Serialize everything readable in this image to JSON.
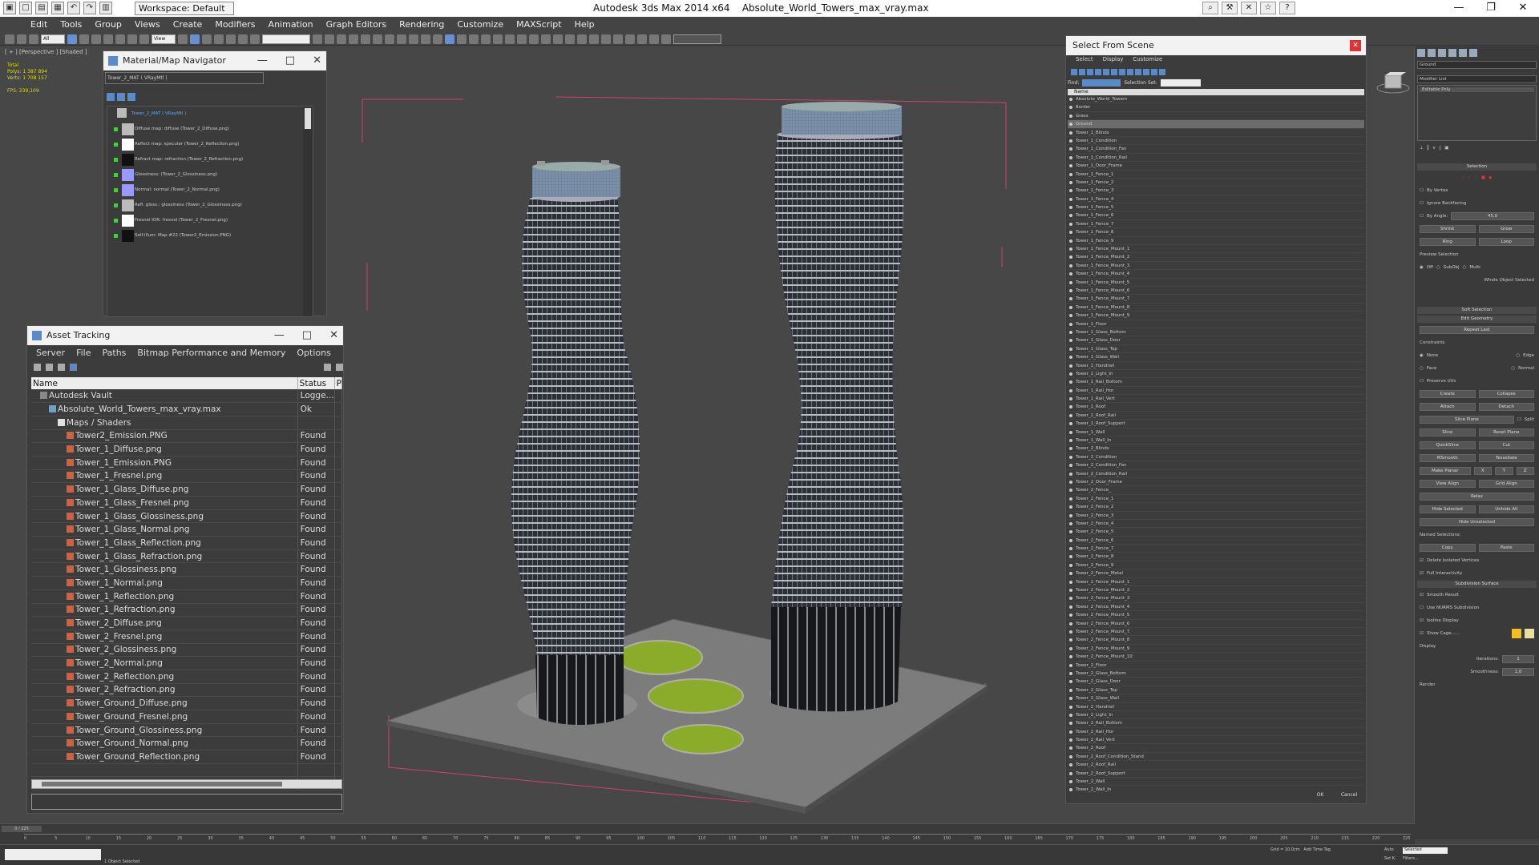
{
  "app": {
    "title": "Autodesk 3ds Max  2014 x64",
    "file": "Absolute_World_Towers_max_vray.max",
    "workspace": "Workspace: Default"
  },
  "menu": [
    "Edit",
    "Tools",
    "Group",
    "Views",
    "Create",
    "Modifiers",
    "Animation",
    "Graph Editors",
    "Rendering",
    "Customize",
    "MAXScript",
    "Help"
  ],
  "toolbar": {
    "selection_filter": "All",
    "view_mode": "View"
  },
  "viewport": {
    "label": "[ + ] [Perspective ] [Shaded ]",
    "stats": {
      "total_label": "Total",
      "polys_label": "Polys:",
      "polys": "1 387 894",
      "verts_label": "Verts:",
      "verts": "1 708 157",
      "fps_label": "FPS:",
      "fps": "239,109"
    }
  },
  "material_navigator": {
    "title": "Material/Map Navigator",
    "path": "Tower_2_MAT  ( VRayMtl )",
    "items": [
      {
        "label": "Tower_2_MAT  ( VRayMtl )",
        "thumb": "top"
      },
      {
        "label": "Diffuse map: diffuse (Tower_2_Diffuse.png)",
        "thumb": "gy"
      },
      {
        "label": "Reflect map: specular (Tower_2_Reflection.png)",
        "thumb": "wh"
      },
      {
        "label": "Refract map: refraction (Tower_2_Refraction.png)",
        "thumb": "dk"
      },
      {
        "label": "Glossiness: (Tower_2_Glossiness.png)",
        "thumb": "pu"
      },
      {
        "label": "Normal: normal (Tower_2_Normal.png)",
        "thumb": "pu"
      },
      {
        "label": "Refl. gloss.: glossiness (Tower_2_Glossiness.png)",
        "thumb": "gy"
      },
      {
        "label": "Fresnel IOR: fresnel (Tower_2_Fresnel.png)",
        "thumb": "wh"
      },
      {
        "label": "Self-illum: Map #22 (Tower2_Emission.PNG)",
        "thumb": "dk"
      }
    ]
  },
  "asset_tracking": {
    "title": "Asset Tracking",
    "menu": [
      "Server",
      "File",
      "Paths",
      "Bitmap Performance and Memory",
      "Options"
    ],
    "columns": {
      "name": "Name",
      "status": "Status",
      "p": "P"
    },
    "rows": [
      {
        "name": "Autodesk Vault",
        "status": "Logge...",
        "indent": 1,
        "icon": "v"
      },
      {
        "name": "Absolute_World_Towers_max_vray.max",
        "status": "Ok",
        "indent": 2,
        "icon": "m"
      },
      {
        "name": "Maps / Shaders",
        "status": "",
        "indent": 3,
        "icon": "f"
      },
      {
        "name": "Tower2_Emission.PNG",
        "status": "Found",
        "indent": 4,
        "icon": "i"
      },
      {
        "name": "Tower_1_Diffuse.png",
        "status": "Found",
        "indent": 4,
        "icon": "i"
      },
      {
        "name": "Tower_1_Emission.PNG",
        "status": "Found",
        "indent": 4,
        "icon": "i"
      },
      {
        "name": "Tower_1_Fresnel.png",
        "status": "Found",
        "indent": 4,
        "icon": "i"
      },
      {
        "name": "Tower_1_Glass_Diffuse.png",
        "status": "Found",
        "indent": 4,
        "icon": "i"
      },
      {
        "name": "Tower_1_Glass_Fresnel.png",
        "status": "Found",
        "indent": 4,
        "icon": "i"
      },
      {
        "name": "Tower_1_Glass_Glossiness.png",
        "status": "Found",
        "indent": 4,
        "icon": "i"
      },
      {
        "name": "Tower_1_Glass_Normal.png",
        "status": "Found",
        "indent": 4,
        "icon": "i"
      },
      {
        "name": "Tower_1_Glass_Reflection.png",
        "status": "Found",
        "indent": 4,
        "icon": "i"
      },
      {
        "name": "Tower_1_Glass_Refraction.png",
        "status": "Found",
        "indent": 4,
        "icon": "i"
      },
      {
        "name": "Tower_1_Glossiness.png",
        "status": "Found",
        "indent": 4,
        "icon": "i"
      },
      {
        "name": "Tower_1_Normal.png",
        "status": "Found",
        "indent": 4,
        "icon": "i"
      },
      {
        "name": "Tower_1_Reflection.png",
        "status": "Found",
        "indent": 4,
        "icon": "i"
      },
      {
        "name": "Tower_1_Refraction.png",
        "status": "Found",
        "indent": 4,
        "icon": "i"
      },
      {
        "name": "Tower_2_Diffuse.png",
        "status": "Found",
        "indent": 4,
        "icon": "i"
      },
      {
        "name": "Tower_2_Fresnel.png",
        "status": "Found",
        "indent": 4,
        "icon": "i"
      },
      {
        "name": "Tower_2_Glossiness.png",
        "status": "Found",
        "indent": 4,
        "icon": "i"
      },
      {
        "name": "Tower_2_Normal.png",
        "status": "Found",
        "indent": 4,
        "icon": "i"
      },
      {
        "name": "Tower_2_Reflection.png",
        "status": "Found",
        "indent": 4,
        "icon": "i"
      },
      {
        "name": "Tower_2_Refraction.png",
        "status": "Found",
        "indent": 4,
        "icon": "i"
      },
      {
        "name": "Tower_Ground_Diffuse.png",
        "status": "Found",
        "indent": 4,
        "icon": "i"
      },
      {
        "name": "Tower_Ground_Fresnel.png",
        "status": "Found",
        "indent": 4,
        "icon": "i"
      },
      {
        "name": "Tower_Ground_Glossiness.png",
        "status": "Found",
        "indent": 4,
        "icon": "i"
      },
      {
        "name": "Tower_Ground_Normal.png",
        "status": "Found",
        "indent": 4,
        "icon": "i"
      },
      {
        "name": "Tower_Ground_Reflection.png",
        "status": "Found",
        "indent": 4,
        "icon": "i"
      }
    ]
  },
  "select_from_scene": {
    "title": "Select From Scene",
    "menu": [
      "Select",
      "Display",
      "Customize"
    ],
    "find_label": "Find:",
    "selection_set_label": "Selection Set:",
    "column": "Name",
    "items": [
      "Absolute_World_Towers",
      "Border",
      "Grass",
      "Ground",
      "Tower_1_Blinds",
      "Tower_1_Condition",
      "Tower_1_Condition_Fan",
      "Tower_1_Condition_Rail",
      "Tower_1_Door_Frame",
      "Tower_1_Fence_1",
      "Tower_1_Fence_2",
      "Tower_1_Fence_3",
      "Tower_1_Fence_4",
      "Tower_1_Fence_5",
      "Tower_1_Fence_6",
      "Tower_1_Fence_7",
      "Tower_1_Fence_8",
      "Tower_1_Fence_9",
      "Tower_1_Fence_Mount_1",
      "Tower_1_Fence_Mount_2",
      "Tower_1_Fence_Mount_3",
      "Tower_1_Fence_Mount_4",
      "Tower_1_Fence_Mount_5",
      "Tower_1_Fence_Mount_6",
      "Tower_1_Fence_Mount_7",
      "Tower_1_Fence_Mount_8",
      "Tower_1_Fence_Mount_9",
      "Tower_1_Floor",
      "Tower_1_Glass_Bottom",
      "Tower_1_Glass_Door",
      "Tower_1_Glass_Top",
      "Tower_1_Glass_Wall",
      "Tower_1_Handrail",
      "Tower_1_Light_In",
      "Tower_1_Rail_Bottom",
      "Tower_1_Rail_Hor",
      "Tower_1_Rail_Vert",
      "Tower_1_Roof",
      "Tower_1_Roof_Rail",
      "Tower_1_Roof_Support",
      "Tower_1_Wall",
      "Tower_1_Wall_In",
      "Tower_2_Blinds",
      "Tower_2_Condition",
      "Tower_2_Condition_Fan",
      "Tower_2_Condition_Rail",
      "Tower_2_Door_Frame",
      "Tower_2_Fence_",
      "Tower_2_Fence_1",
      "Tower_2_Fence_2",
      "Tower_2_Fence_3",
      "Tower_2_Fence_4",
      "Tower_2_Fence_5",
      "Tower_2_Fence_6",
      "Tower_2_Fence_7",
      "Tower_2_Fence_8",
      "Tower_2_Fence_9",
      "Tower_2_Fence_Metal",
      "Tower_2_Fence_Mount_1",
      "Tower_2_Fence_Mount_2",
      "Tower_2_Fence_Mount_3",
      "Tower_2_Fence_Mount_4",
      "Tower_2_Fence_Mount_5",
      "Tower_2_Fence_Mount_6",
      "Tower_2_Fence_Mount_7",
      "Tower_2_Fence_Mount_8",
      "Tower_2_Fence_Mount_9",
      "Tower_2_Fence_Mount_10",
      "Tower_2_Floor",
      "Tower_2_Glass_Bottom",
      "Tower_2_Glass_Door",
      "Tower_2_Glass_Top",
      "Tower_2_Glass_Wall",
      "Tower_2_Handrail",
      "Tower_2_Light_In",
      "Tower_2_Rail_Bottom",
      "Tower_2_Rail_Hor",
      "Tower_2_Rail_Vert",
      "Tower_2_Roof",
      "Tower_2_Roof_Condition_Stand",
      "Tower_2_Roof_Rail",
      "Tower_2_Roof_Support",
      "Tower_2_Wall",
      "Tower_2_Wall_In"
    ],
    "highlight": "Ground",
    "ok": "OK",
    "cancel": "Cancel"
  },
  "command_panel": {
    "object_name": "Ground",
    "modifier_list": "Modifier List",
    "stack_item": "Editable Poly",
    "selection": "Selection",
    "by_vertex": "By Vertex",
    "ignore_backfacing": "Ignore Backfacing",
    "by_angle": "By Angle:",
    "angle_value": "45,0",
    "shrink": "Shrink",
    "grow": "Grow",
    "ring": "Ring",
    "loop": "Loop",
    "preview_selection": "Preview Selection",
    "off": "Off",
    "subobj": "SubObj",
    "multi": "Multi",
    "whole_object_selected": "Whole Object Selected",
    "soft_selection": "Soft Selection",
    "edit_geometry": "Edit Geometry",
    "repeat_last": "Repeat Last",
    "constraints": "Constraints",
    "none": "None",
    "edge": "Edge",
    "face": "Face",
    "normal": "Normal",
    "preserve_uvs": "Preserve UVs",
    "create": "Create",
    "collapse": "Collapse",
    "attach": "Attach",
    "detach": "Detach",
    "slice_plane": "Slice Plane",
    "split": "Split",
    "slice": "Slice",
    "reset_plane": "Reset Plane",
    "quickslice": "QuickSlice",
    "cut": "Cut",
    "msmooth": "MSmooth",
    "tessellate": "Tessellate",
    "make_planar": "Make Planar",
    "x": "X",
    "y": "Y",
    "z": "Z",
    "view_align": "View Align",
    "grid_align": "Grid Align",
    "relax": "Relax",
    "hide_selected": "Hide Selected",
    "unhide_all": "Unhide All",
    "hide_unselected": "Hide Unselected",
    "named_selections": "Named Selections:",
    "copy": "Copy",
    "paste": "Paste",
    "delete_isolated": "Delete Isolated Vertices",
    "full_interactivity": "Full Interactivity",
    "subdivision_surface": "Subdivision Surface",
    "smooth_result": "Smooth Result",
    "use_nurms": "Use NURMS Subdivision",
    "isoline_display": "Isoline Display",
    "show_cage": "Show Cage......",
    "display": "Display",
    "iterations": "Iterations:",
    "iterations_val": "1",
    "smoothness": "Smoothness:",
    "smoothness_val": "1,0",
    "render": "Render",
    "cage_color_1": "#f0c020",
    "cage_color_2": "#e8e0a0"
  },
  "timeline": {
    "frame": "0 / 225",
    "ticks": [
      "0",
      "5",
      "10",
      "15",
      "20",
      "25",
      "30",
      "35",
      "40",
      "45",
      "50",
      "55",
      "60",
      "65",
      "70",
      "75",
      "80",
      "85",
      "90",
      "95",
      "100",
      "105",
      "110",
      "115",
      "120",
      "125",
      "130",
      "135",
      "140",
      "145",
      "150",
      "155",
      "160",
      "165",
      "170",
      "175",
      "180",
      "185",
      "190",
      "195",
      "200",
      "205",
      "210",
      "215",
      "220",
      "225"
    ]
  },
  "status": {
    "hint": "1 Object Selected",
    "grid": "Grid = 10,0cm",
    "add_time_tag": "Add Time Tag",
    "selected": "Selected",
    "auto": "Auto",
    "set_key": "Set K.",
    "filters": "Filters..."
  },
  "colors": {
    "accent": "#5a8ac8",
    "tower_glass": "#2d3038",
    "grass": "#8aac2a",
    "bbox": "#d04070"
  }
}
